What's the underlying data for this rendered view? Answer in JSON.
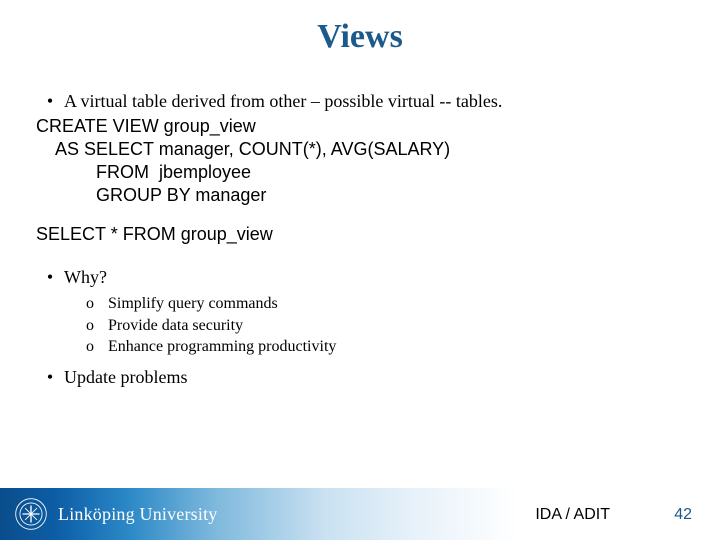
{
  "title": "Views",
  "bullets": {
    "intro": "A virtual table derived from other – possible virtual -- tables.",
    "why_label": "Why?",
    "update_label": "Update problems"
  },
  "code": "CREATE VIEW group_view\n    AS SELECT manager, COUNT(*), AVG(SALARY)\n            FROM  jbemployee\n            GROUP BY manager",
  "query": "SELECT * FROM group_view",
  "why_items": [
    "Simplify query commands",
    "Provide data security",
    "Enhance programming productivity"
  ],
  "footer": {
    "university": "Linköping University",
    "dept": "IDA / ADIT",
    "page": "42"
  }
}
